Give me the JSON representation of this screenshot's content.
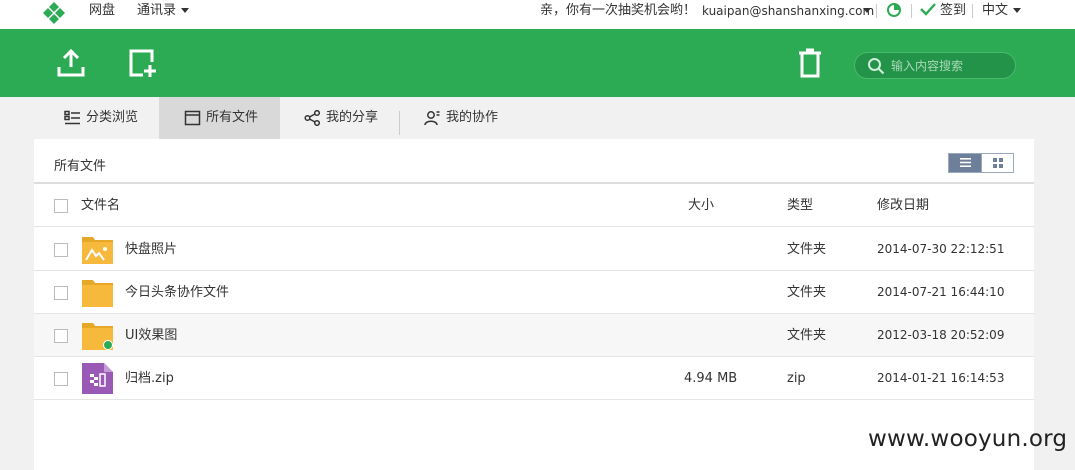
{
  "topbar": {
    "nav": [
      "网盘",
      "通讯录"
    ],
    "promo": "亲，你有一次抽奖机会哟！",
    "email": "kuaipan@shanshanxing.com",
    "checkin": "签到",
    "language": "中文"
  },
  "toolbar": {
    "search_placeholder": "输入内容搜索"
  },
  "tabs": [
    {
      "label": "分类浏览",
      "icon": "category-icon",
      "active": false
    },
    {
      "label": "所有文件",
      "icon": "file-icon",
      "active": true
    },
    {
      "label": "我的分享",
      "icon": "share-icon",
      "active": false
    },
    {
      "label": "我的协作",
      "icon": "collaborate-icon",
      "active": false
    }
  ],
  "breadcrumb": "所有文件",
  "table": {
    "columns": [
      "文件名",
      "大小",
      "类型",
      "修改日期"
    ],
    "rows": [
      {
        "name": "快盘照片",
        "size": "",
        "type": "文件夹",
        "date": "2014-07-30 22:12:51",
        "icon": "photo-folder-icon"
      },
      {
        "name": "今日头条协作文件",
        "size": "",
        "type": "文件夹",
        "date": "2014-07-21 16:44:10",
        "icon": "folder-icon"
      },
      {
        "name": "UI效果图",
        "size": "",
        "type": "文件夹",
        "date": "2012-03-18 20:52:09",
        "icon": "shared-folder-icon"
      },
      {
        "name": "归档.zip",
        "size": "4.94 MB",
        "type": "zip",
        "date": "2014-01-21 16:14:53",
        "icon": "zip-file-icon"
      }
    ]
  },
  "watermark": "www.wooyun.org",
  "colors": {
    "brand_green": "#2daa54",
    "folder_yellow": "#f6b93b",
    "zip_purple": "#9b59b6"
  }
}
